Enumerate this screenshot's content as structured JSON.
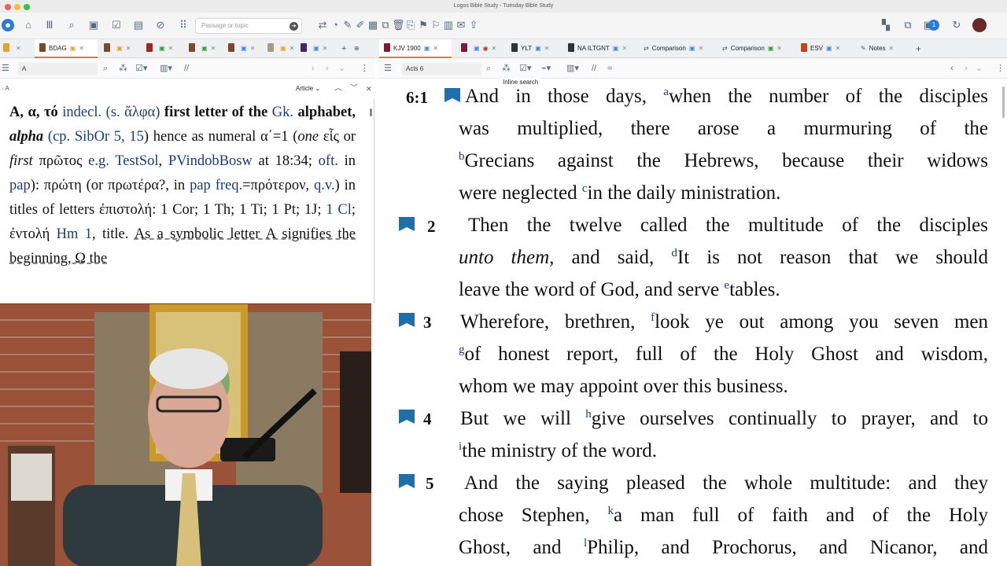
{
  "window": {
    "title": "Logos Bible Study - Tuesday Bible Study"
  },
  "toolbar": {
    "passage_placeholder": "Passage or topic",
    "notification_count": "1"
  },
  "tabs": {
    "left": [
      {
        "label": "BDAG",
        "active": true,
        "color": "#7a4b2a"
      },
      {
        "label": "",
        "color": "#7a4b2a"
      },
      {
        "label": "",
        "color": "#a02a1a"
      },
      {
        "label": "",
        "color": "#7a4b2a"
      },
      {
        "label": "",
        "color": "#7a4b2a"
      },
      {
        "label": "",
        "color": "#a89a80"
      },
      {
        "label": "",
        "color": "#3a2a6a"
      },
      {
        "label": "",
        "color": "#3a2a6a"
      }
    ],
    "right": [
      {
        "label": "KJV 1900",
        "active": true,
        "color": "#7a1a3a"
      },
      {
        "label": "",
        "color": "#7a1a3a"
      },
      {
        "label": "YLT",
        "color": "#333333"
      },
      {
        "label": "NA ILTGNT",
        "color": "#333333"
      },
      {
        "label": "Comparison",
        "color": "#555555"
      },
      {
        "label": "Comparison",
        "color": "#555555"
      },
      {
        "label": "ESV",
        "color": "#c4451a"
      },
      {
        "label": "Notes",
        "color": "#555555"
      }
    ]
  },
  "left_pane": {
    "reference": "A",
    "view_mode": "Article",
    "breadcrumb": "A"
  },
  "right_pane": {
    "reference": "Acts 6",
    "tooltip": "Inline search"
  },
  "lexicon": {
    "headword": "A, α, τό",
    "p1": "indecl.",
    "p2": "(s. ",
    "p3": "ἄλφα",
    "p4": ")",
    "p5": "first letter of the",
    "p6": "Gk.",
    "p7": "alphabet,",
    "p8": "alpha",
    "p9": "(",
    "p10": "cp.",
    "p11": "SibOr 5, 15",
    "p12": ") hence as numeral α΄=1 (",
    "p13": "one",
    "p14": " εἷς or ",
    "p15": "first",
    "p16": " πρῶτος ",
    "p17": "e.g.",
    "p18": "TestSol",
    "p19": ",",
    "p20": "PVindobBosw",
    "p21": " at 18:34; ",
    "p22": "oft.",
    "p23": " in ",
    "p24": "pap",
    "p25": "): πρώτη (or πρωτέρα?, in ",
    "p26": "pap",
    "p27": "freq.",
    "p28": "=πρότερον,",
    "p29": "q.v.",
    "p30": ") in titles of letters ἐπιστολή: 1 Cor; 1 Th; 1 Ti; 1 Pt; 1J; ",
    "p31": "1 Cl",
    "p32": "; ἐντολή ",
    "p33": "Hm 1",
    "p34": ", title. ",
    "p35": "As a symbolic letter A signifies the beginning, Ω the"
  },
  "verses": [
    {
      "num": "6:1"
    },
    {
      "num": "2"
    },
    {
      "num": "3"
    },
    {
      "num": "4"
    },
    {
      "num": "5"
    }
  ],
  "bible_lines": {
    "l1a": "And in those days, ",
    "l1fn": "a",
    "l1b": "when the number of the disciples",
    "l2": "was multiplied, there arose a murmuring of the",
    "l3fn": "b",
    "l3": "Grecians against the Hebrews, because their widows",
    "l4a": "were neglected ",
    "l4fn": "c",
    "l4b": "in the daily ministration.",
    "l5": "Then the twelve called the multitude of the disciples",
    "l6a": "unto them",
    "l6b": ", and said, ",
    "l6fn": "d",
    "l6c": "It is not reason that we should",
    "l7a": "leave the word of God, and serve ",
    "l7fn": "e",
    "l7b": "tables.",
    "l8a": "Wherefore, brethren, ",
    "l8fn": "f",
    "l8b": "look ye out among you seven men",
    "l9fn": "g",
    "l9": "of honest report, full of the Holy Ghost and wisdom,",
    "l10": "whom we may appoint over this business.",
    "l11a": "But we will ",
    "l11fn": "h",
    "l11b": "give ourselves continually to prayer, and to",
    "l12fn": "i",
    "l12": "the ministry of the word.",
    "l13": "And the saying pleased the whole multitude: and they",
    "l14a": "chose Stephen, ",
    "l14fn": "k",
    "l14b": "a man full of faith and of the Holy",
    "l15a": "Ghost, and ",
    "l15fn": "l",
    "l15b": "Philip, and Prochorus, and Nicanor, and"
  },
  "colors": {
    "accent": "#e8772e",
    "link": "#1a3c7a",
    "verse_flag": "#1f6fa8"
  }
}
